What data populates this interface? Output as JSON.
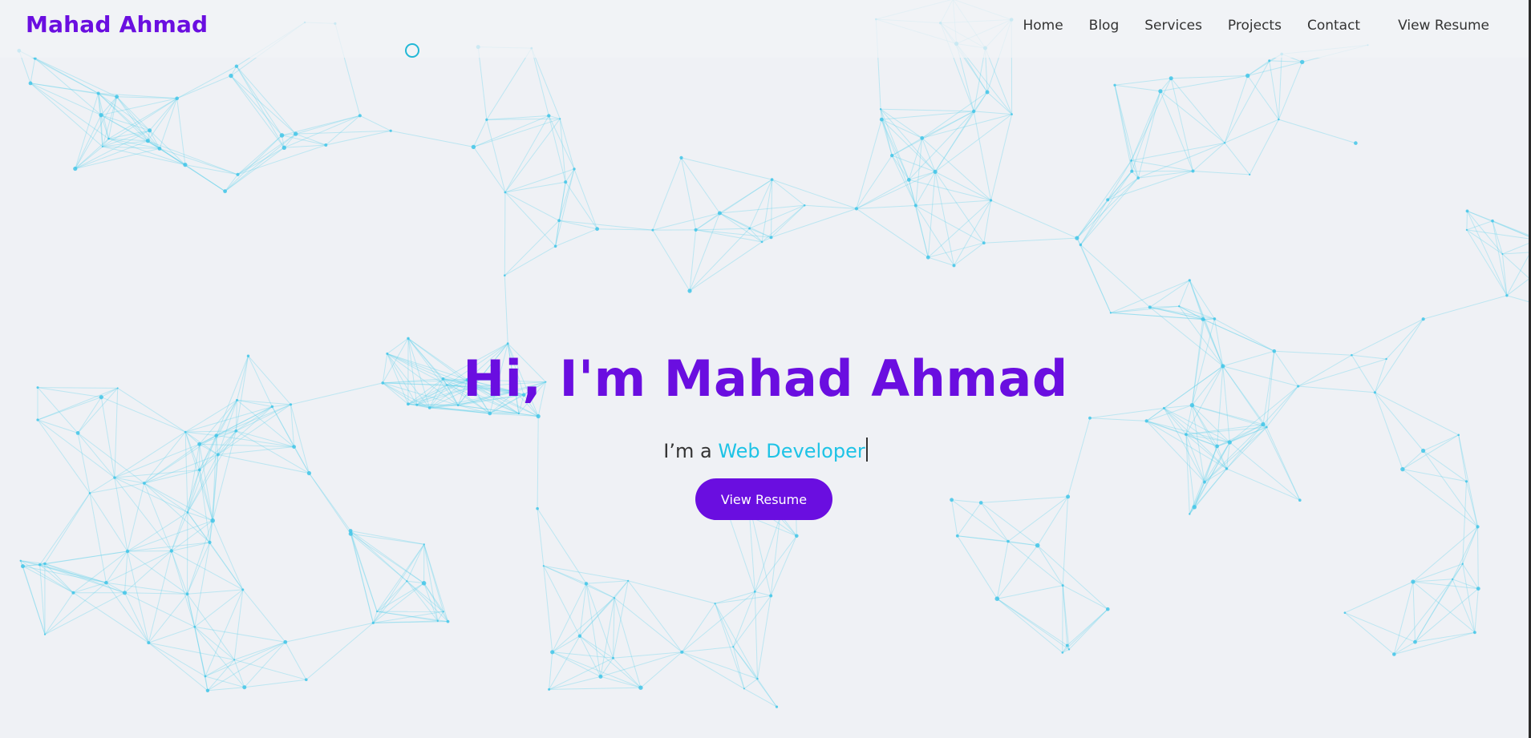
{
  "brand": "Mahad Ahmad",
  "nav": {
    "items": [
      "Home",
      "Blog",
      "Services",
      "Projects",
      "Contact"
    ],
    "resume": "View Resume"
  },
  "hero": {
    "title": "Hi, I'm Mahad Ahmad",
    "prefix": "I’m a ",
    "typed": "Web Developer",
    "button": "View Resume"
  },
  "colors": {
    "accent": "#6a0ee0",
    "typed": "#1ec3e6",
    "background": "#eff1f5",
    "network": "#5fd0ec"
  },
  "icons": {
    "cursor": "cursor-ring-icon"
  }
}
